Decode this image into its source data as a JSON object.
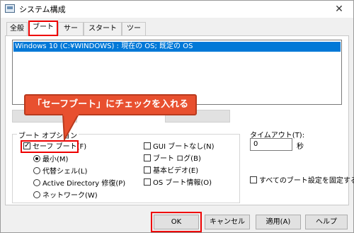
{
  "window": {
    "title": "システム構成",
    "close_glyph": "✕"
  },
  "tabs": [
    {
      "label": "全般"
    },
    {
      "label": "ブート"
    },
    {
      "label": "サービス"
    },
    {
      "label": "スタートアップ"
    },
    {
      "label": "ツール"
    }
  ],
  "boot_entries": [
    {
      "text": "Windows 10 (C:¥WINDOWS) : 現在の OS; 既定の OS"
    }
  ],
  "callout": {
    "text": "「セーフブート」にチェックを入れる",
    "color": "#e8502f"
  },
  "boot_options": {
    "legend": "ブート オプション",
    "safe_boot": {
      "label": "セーフ ブート(F)",
      "checked": true
    },
    "radios": [
      {
        "label": "最小(M)",
        "selected": true
      },
      {
        "label": "代替シェル(L)",
        "selected": false
      },
      {
        "label": "Active Directory 修復(P)",
        "selected": false
      },
      {
        "label": "ネットワーク(W)",
        "selected": false
      }
    ],
    "right_checks": [
      {
        "label": "GUI ブートなし(N)",
        "checked": false
      },
      {
        "label": "ブート ログ(B)",
        "checked": false
      },
      {
        "label": "基本ビデオ(E)",
        "checked": false
      },
      {
        "label": "OS ブート情報(O)",
        "checked": false
      }
    ]
  },
  "timeout": {
    "label": "タイムアウト(T):",
    "value": "0",
    "unit": "秒"
  },
  "permanent": {
    "label": "すべてのブート設定を固定する(K)",
    "checked": false
  },
  "buttons": {
    "ok": "OK",
    "cancel": "キャンセル",
    "apply": "適用(A)",
    "help": "ヘルプ"
  },
  "highlight_color": "#e00000"
}
